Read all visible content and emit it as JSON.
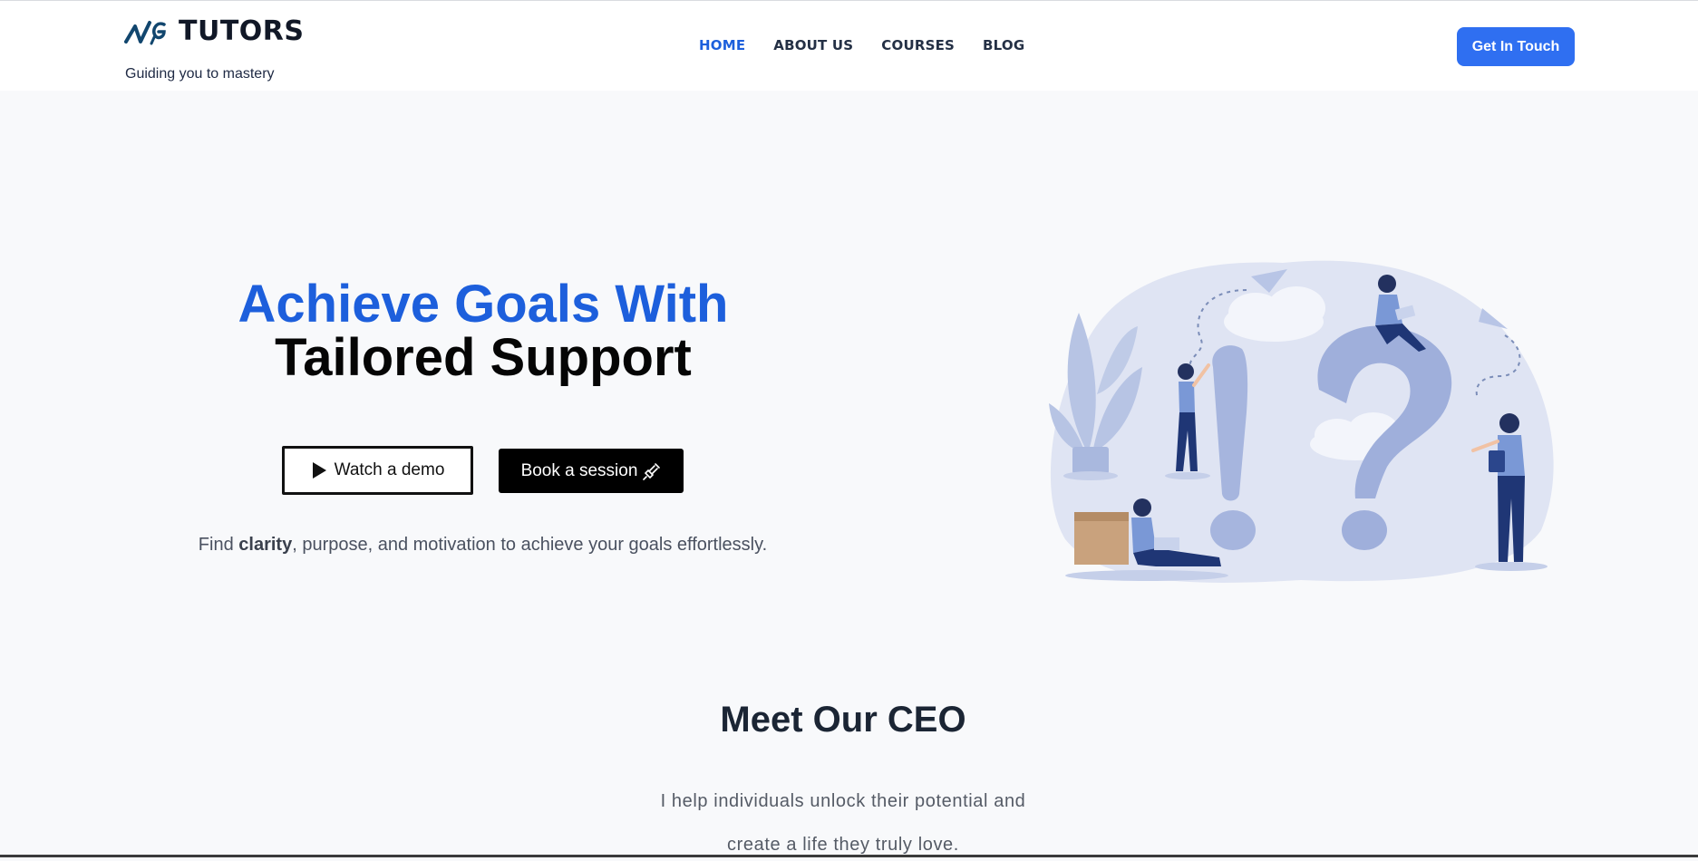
{
  "brand": {
    "name": "TUTORS",
    "tagline": "Guiding you to mastery",
    "accent": "#1d5fdc",
    "cta_color": "#2f6ff1"
  },
  "nav": {
    "items": [
      {
        "label": "HOME",
        "active": true
      },
      {
        "label": "ABOUT US",
        "active": false
      },
      {
        "label": "COURSES",
        "active": false
      },
      {
        "label": "BLOG",
        "active": false
      }
    ],
    "cta_label": "Get In Touch"
  },
  "hero": {
    "title_line1": "Achieve Goals With",
    "title_line2": "Tailored Support",
    "demo_label": "Watch a demo",
    "demo_icon": "play-icon",
    "book_label": "Book a session",
    "book_icon": "plug-icon",
    "sub_prefix": "Find ",
    "sub_bold": "clarity",
    "sub_suffix": ", purpose, and motivation to achieve your goals effortlessly.",
    "illustration": "question-marks-people-illustration"
  },
  "ceo": {
    "title": "Meet Our CEO",
    "text_line1": "I help individuals unlock their potential and",
    "text_line2": "create a life they truly love."
  }
}
